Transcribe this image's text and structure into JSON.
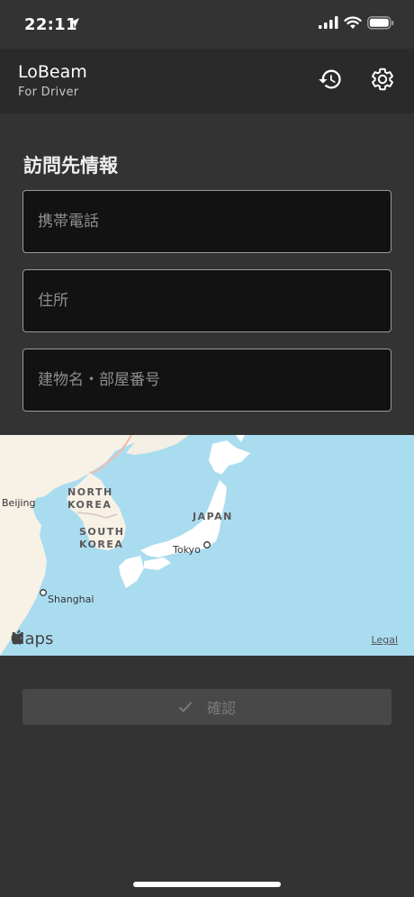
{
  "status_bar": {
    "time": "22:11"
  },
  "header": {
    "title": "LoBeam",
    "subtitle": "For Driver"
  },
  "form": {
    "section_title": "訪問先情報",
    "phone_placeholder": "携帯電話",
    "address_placeholder": "住所",
    "building_placeholder": "建物名・部屋番号"
  },
  "map": {
    "labels": {
      "north_korea_1": "NORTH",
      "north_korea_2": "KOREA",
      "south_korea_1": "SOUTH",
      "south_korea_2": "KOREA",
      "japan": "JAPAN",
      "beijing": "Beijing",
      "tokyo": "Tokyo",
      "shanghai": "Shanghai"
    },
    "attribution": "Maps",
    "legal": "Legal"
  },
  "confirm": {
    "label": "確認"
  }
}
